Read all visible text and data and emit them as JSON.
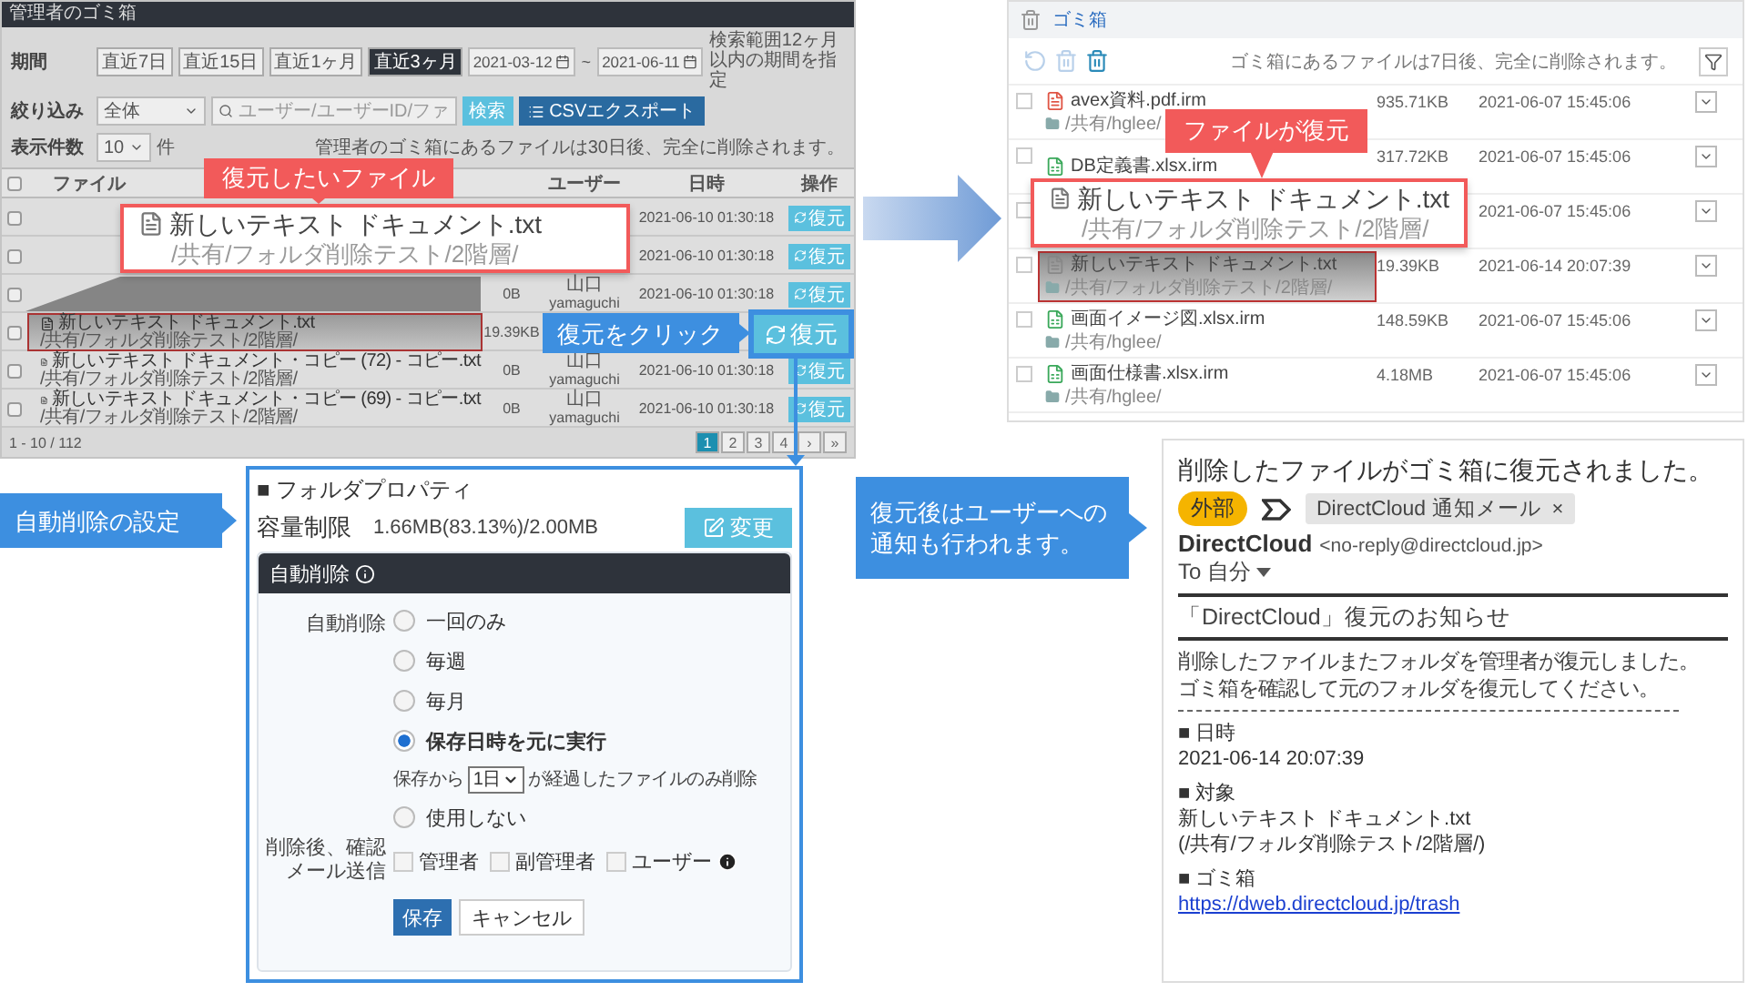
{
  "admin_trash": {
    "title": "管理者のゴミ箱",
    "period_label": "期間",
    "periods": [
      {
        "label": "直近7日",
        "selected": false
      },
      {
        "label": "直近15日",
        "selected": false
      },
      {
        "label": "直近1ヶ月",
        "selected": false
      },
      {
        "label": "直近3ヶ月",
        "selected": true
      }
    ],
    "date_from": "2021-03-12",
    "date_separator": "~",
    "date_to": "2021-06-11",
    "date_note": "検索範囲12ヶ月以内の期間を指定",
    "filter_label": "絞り込み",
    "scope": "全体",
    "search_placeholder": "ユーザー/ユーザーID/ファ",
    "search_button": "検索",
    "export_button": "CSVエクスポート",
    "count_label": "表示件数",
    "count": "10",
    "count_unit": "件",
    "retention_note": "管理者のゴミ箱にあるファイルは30日後、完全に削除されます。",
    "select_all": {
      "checked": false
    },
    "columns": {
      "name": "ファイル",
      "user": "ユーザー",
      "date": "日時",
      "action": "操作"
    },
    "rows": [
      {
        "checked": false,
        "date": "2021-06-10 01:30:18",
        "action": "復元",
        "highlighted": false
      },
      {
        "checked": false,
        "date": "2021-06-10 01:30:18",
        "action": "復元",
        "highlighted": false
      },
      {
        "checked": false,
        "size": "0B",
        "user": "山口",
        "user_id": "yamaguchi",
        "date": "2021-06-10 01:30:18",
        "action": "復元",
        "highlighted": false
      },
      {
        "checked": false,
        "name": "新しいテキスト ドキュメント.txt",
        "path": "/共有/フォルダ削除テスト/2階層/",
        "size": "19.39KB",
        "highlighted": true
      },
      {
        "checked": false,
        "name": "新しいテキスト ドキュメント・コピー (72) - コピー.txt",
        "path": "/共有/フォルダ削除テスト/2階層/",
        "size": "0B",
        "user": "山口",
        "user_id": "yamaguchi",
        "date": "2021-06-10 01:30:18",
        "action": "復元",
        "highlighted": false
      },
      {
        "checked": false,
        "name": "新しいテキスト ドキュメント・コピー (69) - コピー.txt",
        "path": "/共有/フォルダ削除テスト/2階層/",
        "size": "0B",
        "user": "山口",
        "user_id": "yamaguchi",
        "date": "2021-06-10 01:30:18",
        "action": "復元",
        "highlighted": false
      }
    ],
    "pagination": {
      "summary": "1 - 10 / 112",
      "pages": [
        {
          "label": "1",
          "selected": true
        },
        {
          "label": "2",
          "selected": false
        },
        {
          "label": "3",
          "selected": false
        },
        {
          "label": "4",
          "selected": false
        },
        {
          "label": "›",
          "selected": false
        },
        {
          "label": "»",
          "selected": false
        }
      ]
    }
  },
  "restore_callout": {
    "label": "復元したいファイル",
    "file_name": "新しいテキスト ドキュメント.txt",
    "file_path": "/共有/フォルダ削除テスト/2階層/"
  },
  "click_callout": {
    "label": "復元をクリック",
    "button": "復元"
  },
  "user_trash": {
    "title": "ゴミ箱",
    "note": "ゴミ箱にあるファイルは7日後、完全に削除されます。",
    "rows": [
      {
        "checked": false,
        "kind": "pdf",
        "name": "avex資料.pdf.irm",
        "path": "/共有/hglee/",
        "size": "935.71KB",
        "date": "2021-06-07 15:45:06",
        "highlighted": false
      },
      {
        "checked": false,
        "kind": "xlsx",
        "name": "DB定義書.xlsx.irm",
        "size": "317.72KB",
        "date": "2021-06-07 15:45:06",
        "highlighted": false
      },
      {
        "checked": false,
        "date": "2021-06-07 15:45:06"
      },
      {
        "checked": false,
        "kind": "txt",
        "name": "新しいテキスト ドキュメント.txt",
        "path": "/共有/フォルダ削除テスト/2階層/",
        "size": "19.39KB",
        "date": "2021-06-14 20:07:39",
        "highlighted": true
      },
      {
        "checked": false,
        "kind": "xlsx",
        "name": "画面イメージ図.xlsx.irm",
        "path": "/共有/hglee/",
        "size": "148.59KB",
        "date": "2021-06-07 15:45:06",
        "highlighted": false
      },
      {
        "checked": false,
        "kind": "xlsx",
        "name": "画面仕様書.xlsx.irm",
        "path": "/共有/hglee/",
        "size": "4.18MB",
        "date": "2021-06-07 15:45:06",
        "highlighted": false
      }
    ]
  },
  "restored_callout": {
    "label": "ファイルが復元",
    "file_name": "新しいテキスト ドキュメント.txt",
    "file_path": "/共有/フォルダ削除テスト/2階層/"
  },
  "settings_callout": {
    "label": "自動削除の設定"
  },
  "notify_callout": {
    "label": "復元後はユーザーへの通知も行われます。"
  },
  "folder_properties": {
    "title": "■ フォルダプロパティ",
    "capacity_label": "容量制限",
    "capacity": "1.66MB(83.13%)/2.00MB",
    "edit_button": "変更",
    "section_title": "自動削除",
    "field_label": "自動削除",
    "options": [
      {
        "label": "一回のみ",
        "selected": false
      },
      {
        "label": "毎週",
        "selected": false
      },
      {
        "label": "毎月",
        "selected": false
      },
      {
        "label": "保存日時を元に実行",
        "selected": true,
        "retention": {
          "prefix": "保存から",
          "value": "1日",
          "suffix": "が経過したファイルのみ削除"
        }
      },
      {
        "label": "使用しない",
        "selected": false
      }
    ],
    "notify_label": "削除後、確認メール送信",
    "recipients": [
      {
        "label": "管理者",
        "checked": false
      },
      {
        "label": "副管理者",
        "checked": false
      },
      {
        "label": "ユーザー",
        "checked": false,
        "info": true
      }
    ],
    "save_button": "保存",
    "cancel_button": "キャンセル"
  },
  "email": {
    "subject": "削除したファイルがゴミ箱に復元されました。",
    "external_tag": "外部",
    "label_chip": "DirectCloud 通知メール",
    "chip_close": "×",
    "sender_name": "DirectCloud",
    "sender_address": "<no-reply@directcloud.jp>",
    "recipient": "To 自分",
    "heading": "「DirectCloud」復元のお知らせ",
    "body": [
      "削除したファイルまたフォルダを管理者が復元しました。",
      "ゴミ箱を確認して元のフォルダを復元してください。"
    ],
    "sections": [
      {
        "heading": "■ 日時",
        "lines": [
          "2021-06-14 20:07:39"
        ]
      },
      {
        "heading": "■ 対象",
        "lines": [
          "新しいテキスト ドキュメント.txt",
          "(/共有/フォルダ削除テスト/2階層/)"
        ]
      },
      {
        "heading": "■ ゴミ箱",
        "link": "https://dweb.directcloud.jp/trash"
      }
    ]
  }
}
